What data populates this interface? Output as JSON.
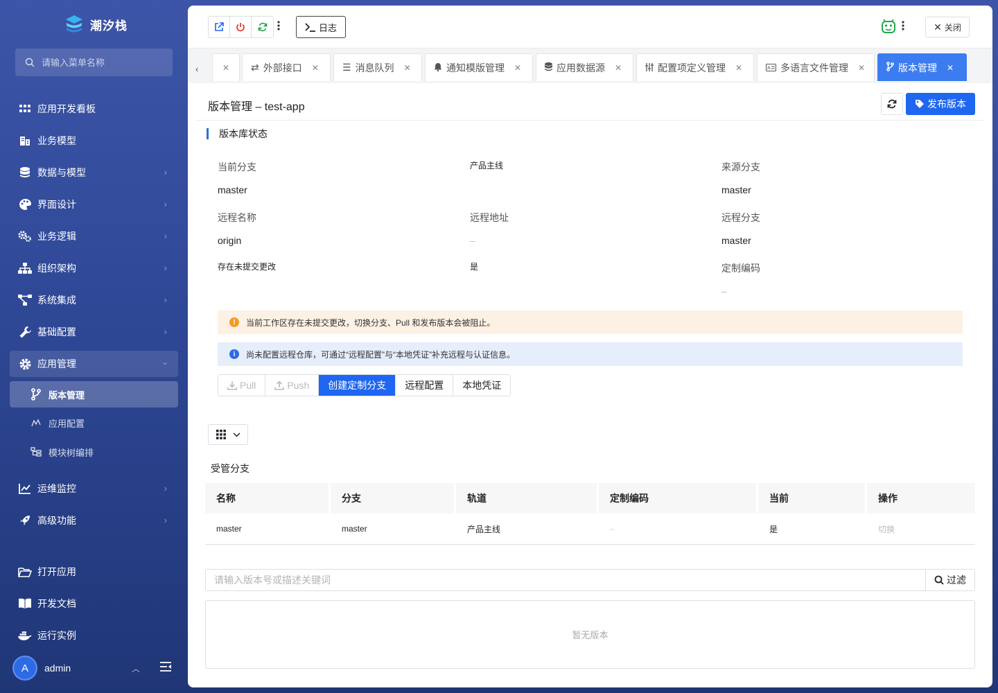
{
  "app": {
    "name": "潮汐栈"
  },
  "sidebar": {
    "search_placeholder": "请输入菜单名称",
    "items": [
      {
        "label": "应用开发看板"
      },
      {
        "label": "业务模型"
      },
      {
        "label": "数据与模型"
      },
      {
        "label": "界面设计"
      },
      {
        "label": "业务逻辑"
      },
      {
        "label": "组织架构"
      },
      {
        "label": "系统集成"
      },
      {
        "label": "基础配置"
      },
      {
        "label": "应用管理"
      },
      {
        "label": "版本管理"
      },
      {
        "label": "应用配置"
      },
      {
        "label": "模块树编排"
      },
      {
        "label": "运维监控"
      },
      {
        "label": "高级功能"
      },
      {
        "label": "打开应用"
      },
      {
        "label": "开发文档"
      },
      {
        "label": "运行实例"
      }
    ],
    "user": {
      "initial": "A",
      "name": "admin"
    }
  },
  "topbar": {
    "log_label": "日志",
    "close_label": "关闭"
  },
  "tabs": [
    {
      "label": "外部接口"
    },
    {
      "label": "消息队列"
    },
    {
      "label": "通知模版管理"
    },
    {
      "label": "应用数据源"
    },
    {
      "label": "配置项定义管理"
    },
    {
      "label": "多语言文件管理"
    },
    {
      "label": "版本管理"
    }
  ],
  "page": {
    "title": "版本管理 – test-app",
    "publish_label": "发布版本"
  },
  "repo_status": {
    "section_title": "版本库状态",
    "current_branch_label": "当前分支",
    "current_branch_value": "master",
    "track_value": "产品主线",
    "source_branch_label": "来源分支",
    "source_branch_value": "master",
    "remote_name_label": "远程名称",
    "remote_name_value": "origin",
    "remote_url_label": "远程地址",
    "remote_url_value": "–",
    "remote_branch_label": "远程分支",
    "remote_branch_value": "master",
    "uncommitted_label": "存在未提交更改",
    "uncommitted_value": "是",
    "custom_code_label": "定制编码",
    "custom_code_value": "–"
  },
  "alerts": {
    "warning": "当前工作区存在未提交更改，切换分支、Pull 和发布版本会被阻止。",
    "info": "尚未配置远程仓库，可通过“远程配置”与“本地凭证”补充远程与认证信息。"
  },
  "actions": {
    "pull": "Pull",
    "push": "Push",
    "create_branch": "创建定制分支",
    "remote_config": "远程配置",
    "local_credentials": "本地凭证"
  },
  "branches": {
    "title": "受管分支",
    "columns": [
      "名称",
      "分支",
      "轨道",
      "定制编码",
      "当前",
      "操作"
    ],
    "rows": [
      {
        "name": "master",
        "branch": "master",
        "track": "产品主线",
        "custom_code": "–",
        "current": "是",
        "action": "切换"
      }
    ]
  },
  "versions": {
    "filter_placeholder": "请输入版本号或描述关键词",
    "filter_label": "过滤",
    "empty_text": "暂无版本"
  },
  "colors": {
    "primary": "#1f66f0",
    "warning_bg": "#fdf1e4",
    "info_bg": "#e6eefc",
    "sidebar_bg": "#2f4896"
  }
}
